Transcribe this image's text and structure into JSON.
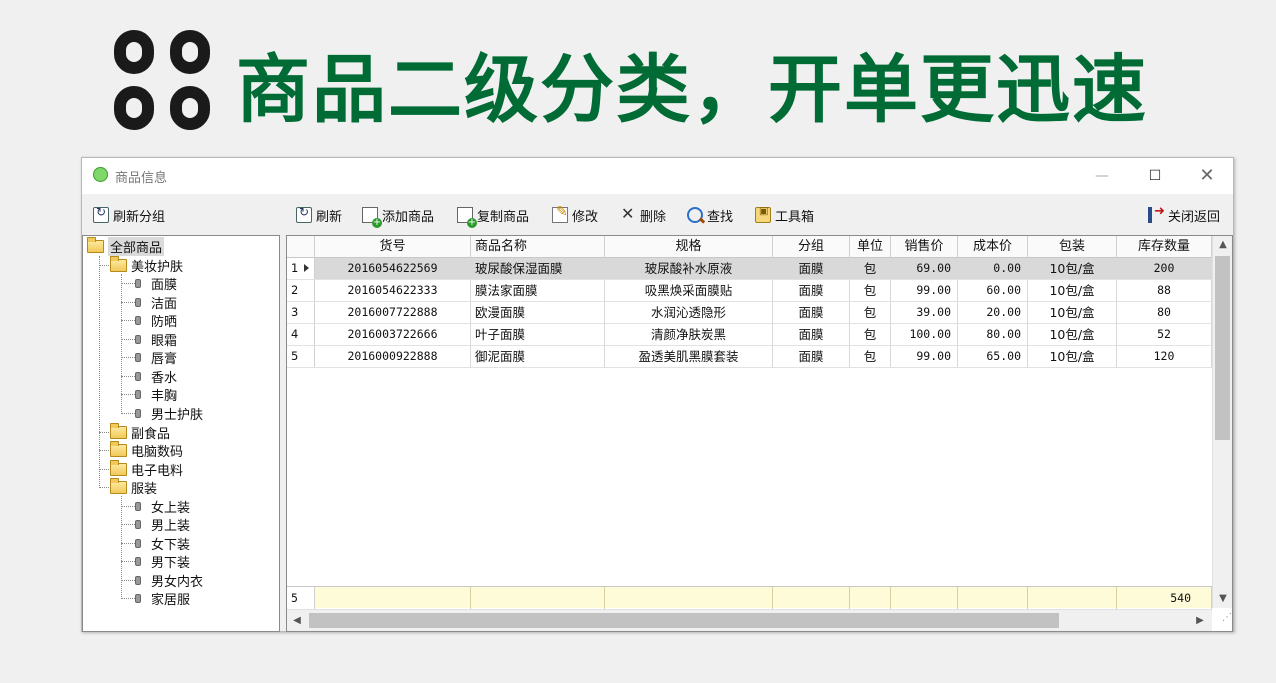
{
  "banner": {
    "slogan": "商品二级分类，开单更迅速",
    "slogan_color": "#006b35"
  },
  "window": {
    "title": "商品信息",
    "min_glyph": "—",
    "max_glyph": "☐",
    "close_glyph": "✕"
  },
  "toolbar": {
    "refresh_category": "刷新分组",
    "refresh": "刷新",
    "add_product": "添加商品",
    "copy_product": "复制商品",
    "edit": "修改",
    "delete": "删除",
    "find": "查找",
    "toolbox": "工具箱",
    "close_return": "关闭返回"
  },
  "tree": {
    "root": "全部商品",
    "groups": [
      {
        "label": "美妆护肤",
        "children": [
          "面膜",
          "洁面",
          "防晒",
          "眼霜",
          "唇膏",
          "香水",
          "丰胸",
          "男士护肤"
        ]
      },
      {
        "label": "副食品",
        "children": []
      },
      {
        "label": "电脑数码",
        "children": []
      },
      {
        "label": "电子电料",
        "children": []
      },
      {
        "label": "服装",
        "children": [
          "女上装",
          "男上装",
          "女下装",
          "男下装",
          "男女内衣",
          "家居服"
        ]
      }
    ]
  },
  "grid": {
    "columns": [
      "货号",
      "商品名称",
      "规格",
      "分组",
      "单位",
      "销售价",
      "成本价",
      "包装",
      "库存数量"
    ],
    "rows": [
      {
        "index": "1",
        "sku": "2016054622569",
        "name": "玻尿酸保湿面膜",
        "spec": "玻尿酸补水原液",
        "group": "面膜",
        "unit": "包",
        "price": "69.00",
        "cost": "0.00",
        "pack": "10包/盒",
        "stock": "200"
      },
      {
        "index": "2",
        "sku": "2016054622333",
        "name": "膜法家面膜",
        "spec": "吸黑焕采面膜贴",
        "group": "面膜",
        "unit": "包",
        "price": "99.00",
        "cost": "60.00",
        "pack": "10包/盒",
        "stock": "88"
      },
      {
        "index": "3",
        "sku": "2016007722888",
        "name": "欧漫面膜",
        "spec": "水润沁透隐形",
        "group": "面膜",
        "unit": "包",
        "price": "39.00",
        "cost": "20.00",
        "pack": "10包/盒",
        "stock": "80"
      },
      {
        "index": "4",
        "sku": "2016003722666",
        "name": "叶子面膜",
        "spec": "清颜净肤炭黑",
        "group": "面膜",
        "unit": "包",
        "price": "100.00",
        "cost": "80.00",
        "pack": "10包/盒",
        "stock": "52"
      },
      {
        "index": "5",
        "sku": "2016000922888",
        "name": "御泥面膜",
        "spec": "盈透美肌黑膜套装",
        "group": "面膜",
        "unit": "包",
        "price": "99.00",
        "cost": "65.00",
        "pack": "10包/盒",
        "stock": "120"
      }
    ],
    "footer": {
      "count": "5",
      "stock_total": "540"
    }
  }
}
